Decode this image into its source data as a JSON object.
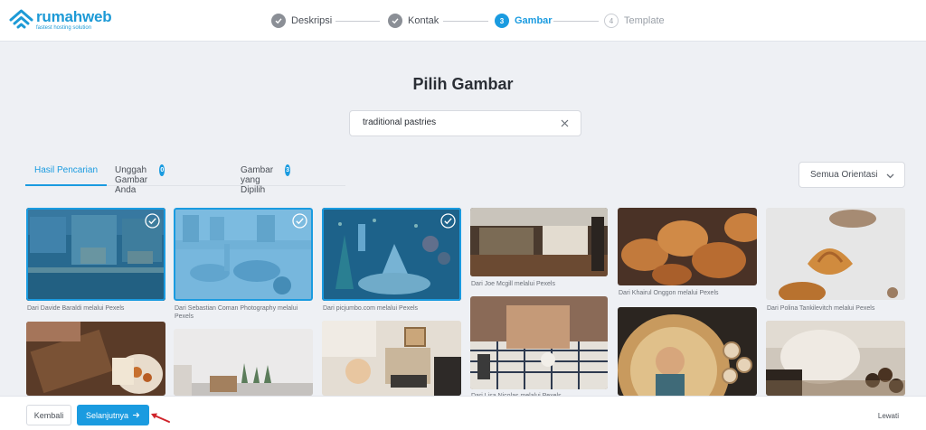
{
  "brand": {
    "name": "rumahweb",
    "tagline": "fastest hosting solution",
    "color": "#1d9ad6"
  },
  "steps": [
    {
      "number": "1",
      "label": "Deskripsi",
      "status": "done"
    },
    {
      "number": "2",
      "label": "Kontak",
      "status": "done"
    },
    {
      "number": "3",
      "label": "Gambar",
      "status": "active"
    },
    {
      "number": "4",
      "label": "Template",
      "status": "todo"
    }
  ],
  "page": {
    "title": "Pilih Gambar"
  },
  "search": {
    "value": "traditional pastries",
    "placeholder": ""
  },
  "tabs": [
    {
      "label": "Hasil Pencarian",
      "active": true
    },
    {
      "label": "Unggah Gambar Anda",
      "badge": "0"
    },
    {
      "label": "Gambar yang Dipilih",
      "badge": "3"
    }
  ],
  "orientation": {
    "selected": "Semua Orientasi"
  },
  "images": [
    {
      "credit": "Dari Davide Baraldi melalui Pexels",
      "selected": true
    },
    {
      "credit": "Dari Sebastian Coman Photography melalui Pexels",
      "selected": true
    },
    {
      "credit": "Dari picjumbo.com melalui Pexels",
      "selected": true
    },
    {
      "credit": "Dari Joe Mcgill melalui Pexels",
      "selected": false
    },
    {
      "credit": "Dari Khairul Onggon melalui Pexels",
      "selected": false
    },
    {
      "credit": "Dari Polina Tankilevitch melalui Pexels",
      "selected": false
    },
    {
      "credit": "",
      "selected": false
    },
    {
      "credit": "",
      "selected": false
    },
    {
      "credit": "",
      "selected": false
    },
    {
      "credit": "Dari Lisa Nicolas melalui Pexels",
      "selected": false
    },
    {
      "credit": "",
      "selected": false
    },
    {
      "credit": "",
      "selected": false
    }
  ],
  "footer": {
    "back": "Kembali",
    "next": "Selanjutnya",
    "skip": "Lewati"
  },
  "colors": {
    "accent": "#1a9be0",
    "annotation_arrow": "#d0242b"
  }
}
